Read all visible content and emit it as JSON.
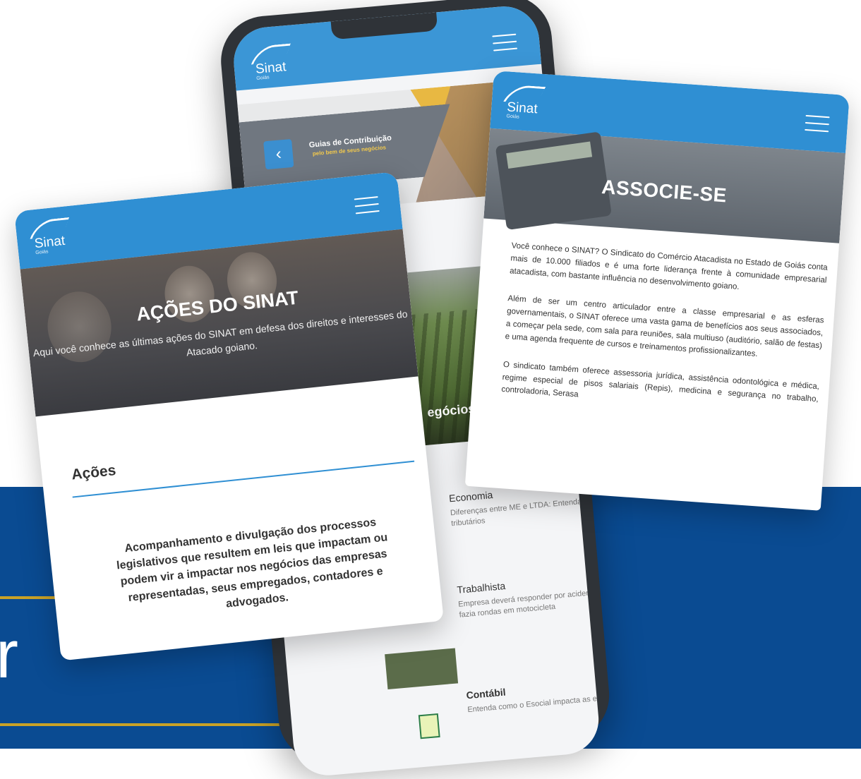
{
  "colors": {
    "band": "#0a4b92",
    "gold": "#c9a227",
    "header_blue": "#2f8fd3",
    "field": "#4f6b34"
  },
  "background_letter": "r",
  "phone": {
    "logo": {
      "name": "Sinat",
      "sub": "Goiás"
    },
    "menu_icon": "hamburger-icon",
    "banner": {
      "back_icon": "chevron-left-icon",
      "back_glyph": "‹",
      "title": "Guias de Contribuição",
      "subtitle": "pelo bem de seus negócios"
    },
    "field_caption": "egócios – Segmento de",
    "news": [
      {
        "category": "Economia",
        "text": "Diferenças entre ME e LTDA: Entenda os impostos e regimes tributários"
      },
      {
        "category": "Trabalhista",
        "text": "Empresa deverá responder por acidente com supervisor que fazia rondas em motocicleta"
      },
      {
        "category": "Contábil",
        "text": "Entenda como o Esocial impacta as empresas"
      }
    ]
  },
  "card_right": {
    "logo": {
      "name": "Sinat",
      "sub": "Goiás"
    },
    "title": "ASSOCIE-SE",
    "paragraphs": [
      "Você conhece o SINAT? O Sindicato do Comércio Atacadista no Estado de Goiás conta mais de 10.000 filiados e é uma forte liderança frente à comunidade empresarial atacadista, com bastante influência no desenvolvimento goiano.",
      "Além de ser um centro articulador entre a classe empresarial e as esferas governamentais, o SINAT oferece uma vasta gama de benefícios aos seus associados, a começar pela sede, com sala para reuniões, sala multiuso (auditório, salão de festas) e uma agenda frequente de cursos e treinamentos profissionalizantes.",
      "O sindicato também oferece assessoria jurídica, assistência odontológica e médica, regime especial de pisos salariais (Repis), medicina e segurança no trabalho, controladoria, Serasa"
    ]
  },
  "card_left": {
    "logo": {
      "name": "Sinat",
      "sub": "Goiás"
    },
    "title": "AÇÕES DO SINAT",
    "subtitle": "Aqui você conhece as últimas ações do SINAT em defesa dos direitos e interesses do Atacado goiano.",
    "section": "Ações",
    "body": "Acompanhamento e divulgação dos processos legislativos que resultem em leis que impactam ou podem vir a impactar nos negócios das empresas representadas, seus empregados, contadores e advogados."
  }
}
